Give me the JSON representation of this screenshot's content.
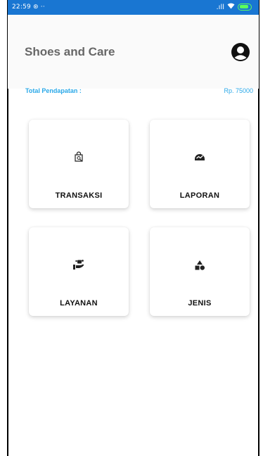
{
  "status_bar": {
    "time": "22:59",
    "icons": [
      "whatsapp-icon",
      "more-dots-icon",
      "signal-icon",
      "wifi-icon",
      "battery-icon"
    ],
    "battery": "85",
    "color": "#1976d2"
  },
  "header": {
    "title": "Shoes and Care",
    "avatar_icon": "user-avatar-icon"
  },
  "income": {
    "label": "Total Pendapatan  :",
    "value": "Rp. 75000",
    "color": "#29a8e8"
  },
  "menu": [
    {
      "label": "TRANSAKSI",
      "icon": "shopping-bag-icon"
    },
    {
      "label": "LAPORAN",
      "icon": "report-chart-icon"
    },
    {
      "label": "LAYANAN",
      "icon": "service-hand-icon"
    },
    {
      "label": "JENIS",
      "icon": "category-shapes-icon"
    }
  ]
}
